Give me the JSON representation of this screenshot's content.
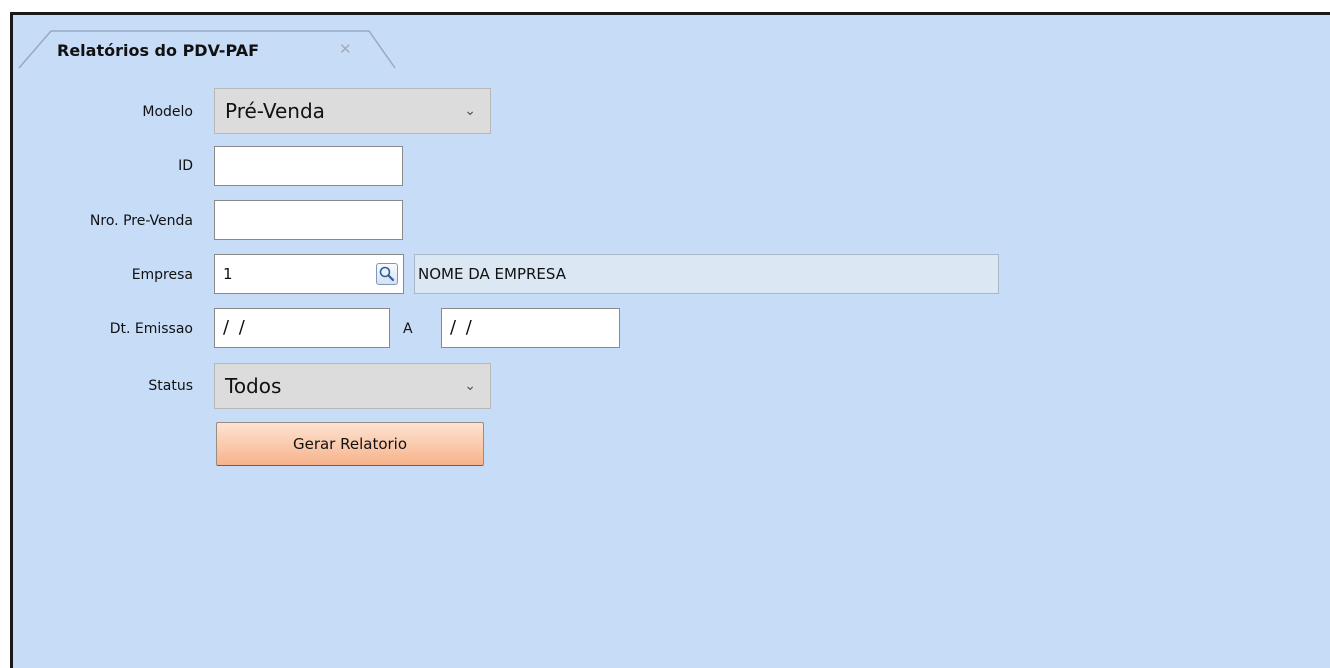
{
  "tab": {
    "title": "Relatórios do PDV-PAF",
    "close_glyph": "✕"
  },
  "form": {
    "modelo": {
      "label": "Modelo",
      "value": "Pré-Venda"
    },
    "id": {
      "label": "ID",
      "value": ""
    },
    "nro_pre_venda": {
      "label": "Nro. Pre-Venda",
      "value": ""
    },
    "empresa": {
      "label": "Empresa",
      "code": "1",
      "name": "NOME DA EMPRESA",
      "search_icon": "search-icon"
    },
    "dt_emissao": {
      "label": "Dt. Emissao",
      "from": "/ /",
      "sep": "A",
      "to": "/ /"
    },
    "status": {
      "label": "Status",
      "value": "Todos"
    },
    "button": {
      "label": "Gerar Relatorio"
    }
  },
  "colors": {
    "background": "#c6dcf7",
    "button_gradient_top": "#fde3d2",
    "button_gradient_bottom": "#f7b38b",
    "combo_bg": "#dcdcdc"
  }
}
